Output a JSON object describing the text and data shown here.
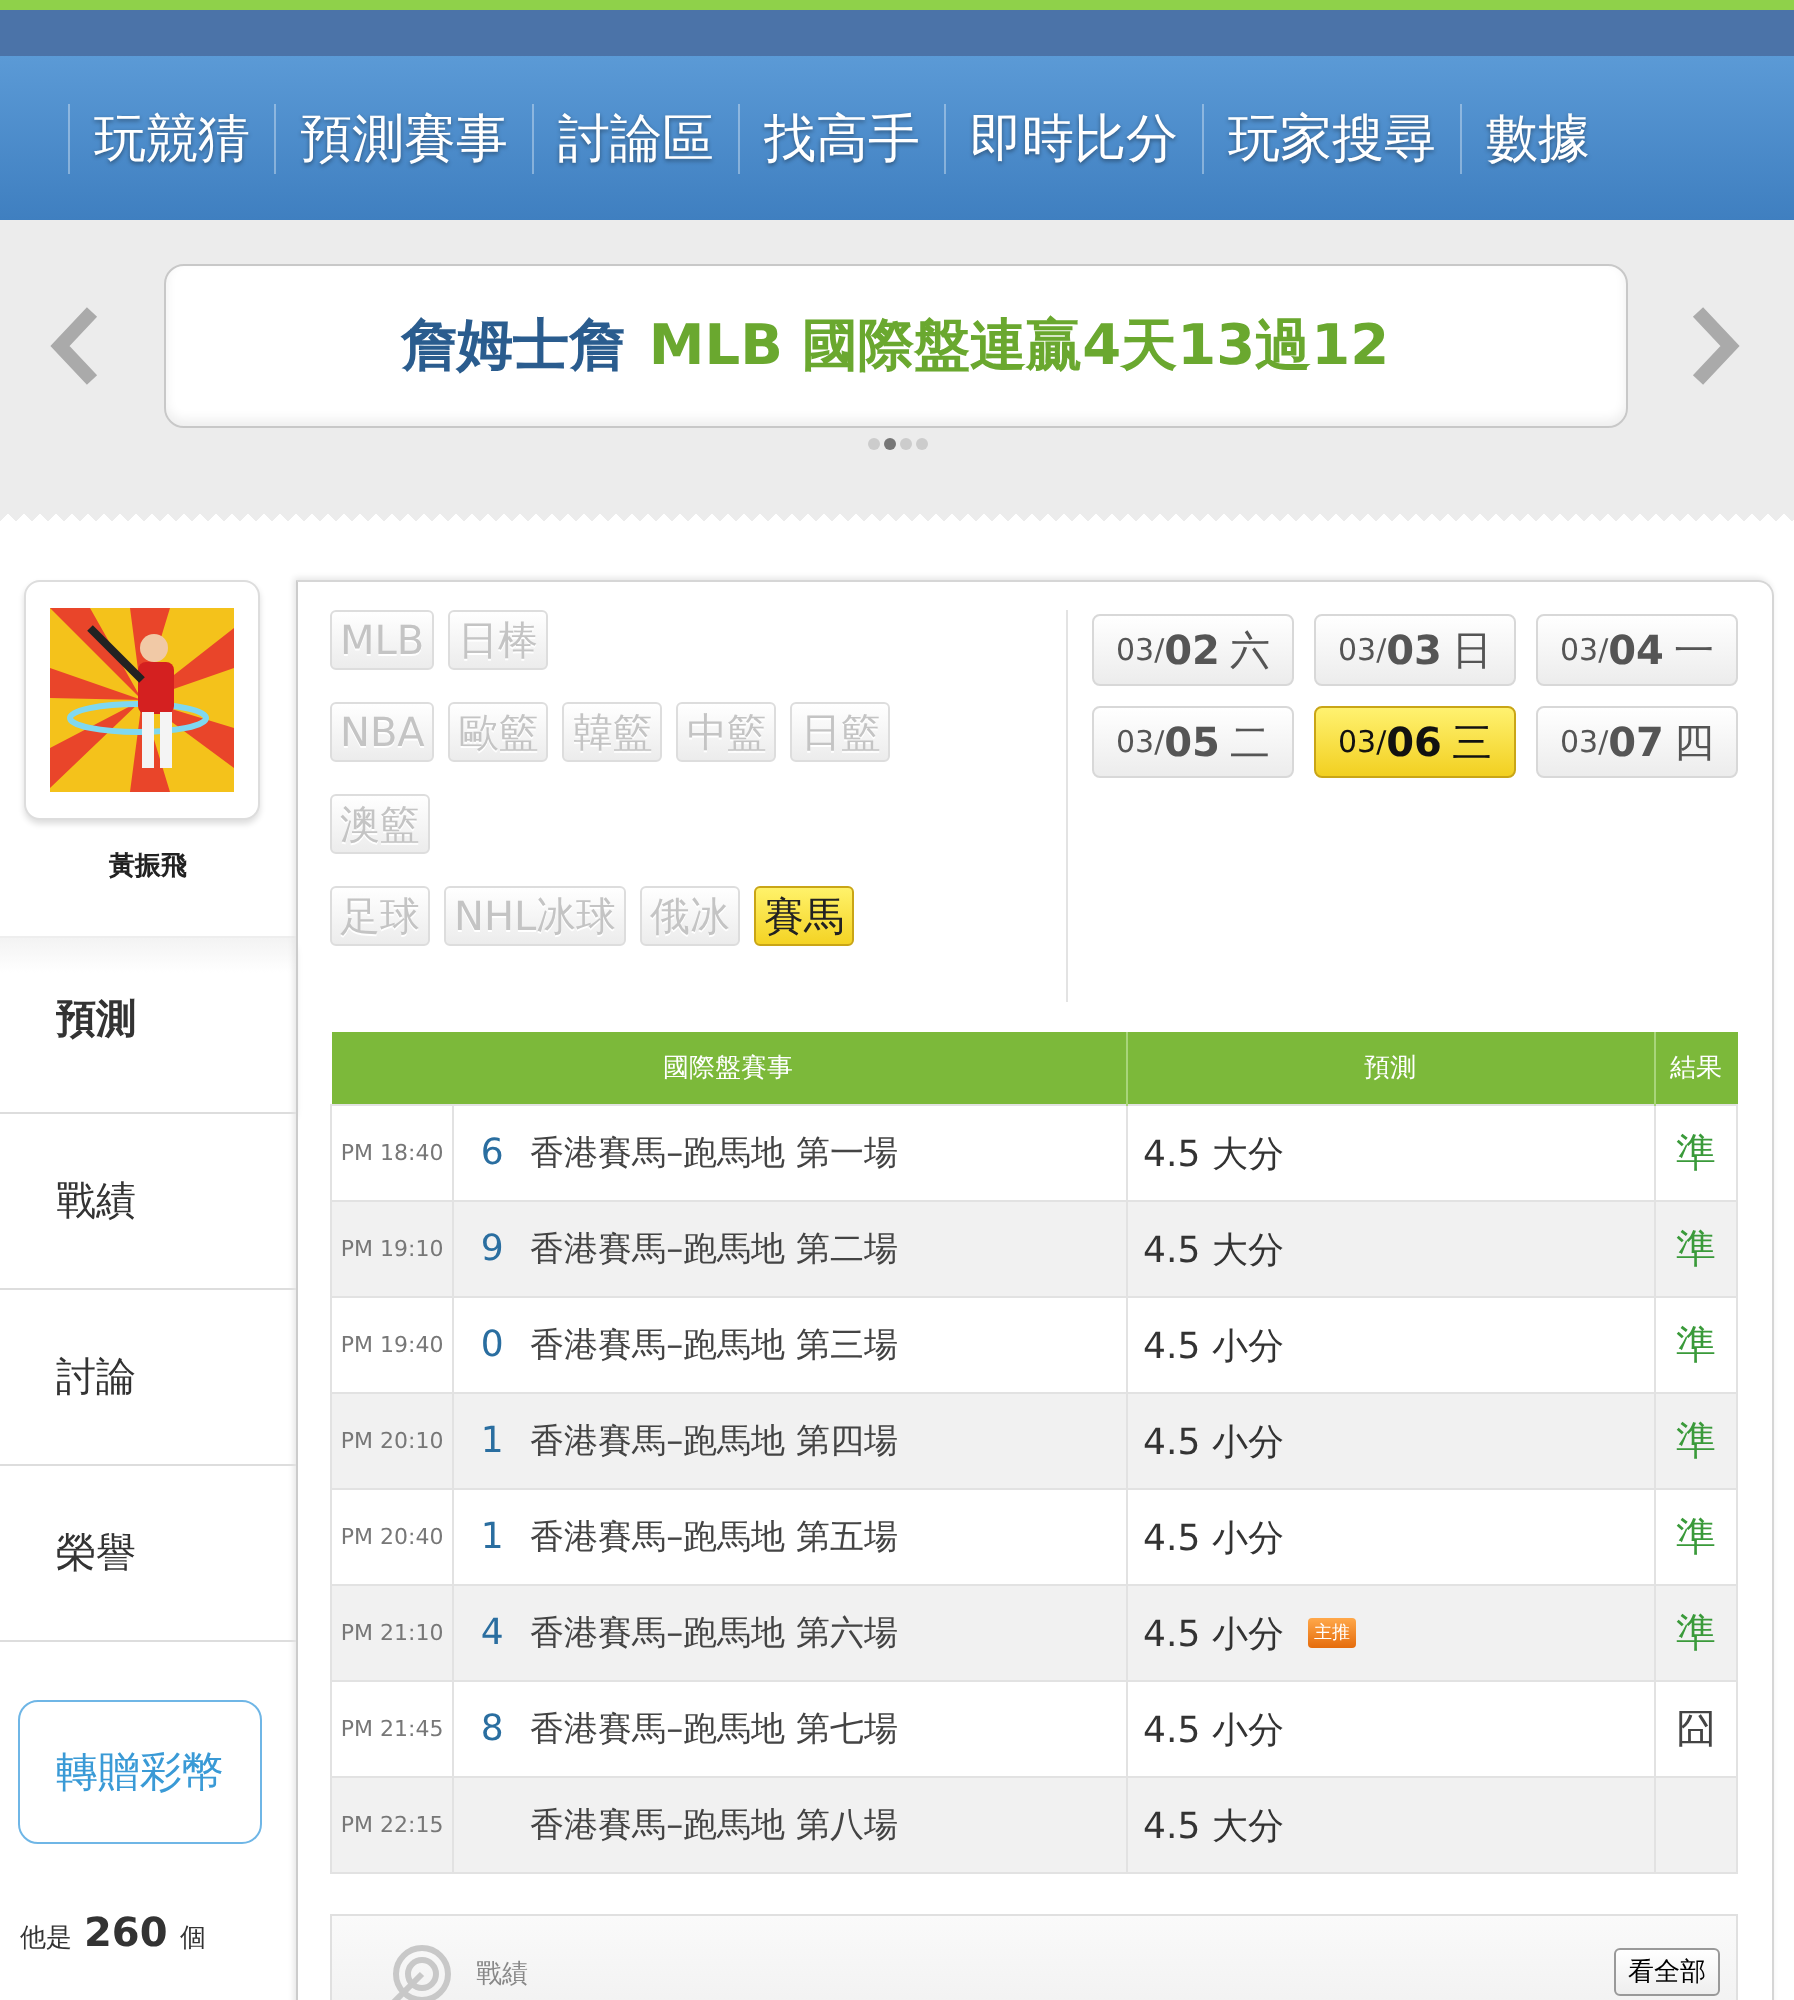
{
  "nav": {
    "items": [
      "玩競猜",
      "預測賽事",
      "討論區",
      "找高手",
      "即時比分",
      "玩家搜尋",
      "數據"
    ]
  },
  "banner": {
    "name": "詹姆士詹",
    "text": "MLB 國際盤連贏4天13過12",
    "dots": [
      {
        "selected": false
      },
      {
        "selected": true
      },
      {
        "selected": false
      },
      {
        "selected": false
      }
    ]
  },
  "profile": {
    "name": "黃振飛"
  },
  "sidebar": {
    "tabs": [
      {
        "label": "預測",
        "selected": true
      },
      {
        "label": "戰績",
        "selected": false
      },
      {
        "label": "討論",
        "selected": false
      },
      {
        "label": "榮譽",
        "selected": false
      }
    ],
    "transfer_button": "轉贈彩幣",
    "stats": {
      "prefix": "他是",
      "count": "260",
      "suffix": "個"
    }
  },
  "leagues": [
    [
      {
        "label": "MLB",
        "selected": false
      },
      {
        "label": "日棒",
        "selected": false
      }
    ],
    [
      {
        "label": "NBA",
        "selected": false
      },
      {
        "label": "歐籃",
        "selected": false
      },
      {
        "label": "韓籃",
        "selected": false
      },
      {
        "label": "中籃",
        "selected": false
      },
      {
        "label": "日籃",
        "selected": false
      }
    ],
    [
      {
        "label": "澳籃",
        "selected": false
      }
    ],
    [
      {
        "label": "足球",
        "selected": false
      },
      {
        "label": "NHL冰球",
        "selected": false
      },
      {
        "label": "俄冰",
        "selected": false
      },
      {
        "label": "賽馬",
        "selected": true
      }
    ]
  ],
  "dates": [
    {
      "month": "03/",
      "day": "02",
      "weekday": "六",
      "selected": false
    },
    {
      "month": "03/",
      "day": "03",
      "weekday": "日",
      "selected": false
    },
    {
      "month": "03/",
      "day": "04",
      "weekday": "一",
      "selected": false
    },
    {
      "month": "03/",
      "day": "05",
      "weekday": "二",
      "selected": false
    },
    {
      "month": "03/",
      "day": "06",
      "weekday": "三",
      "selected": true
    },
    {
      "month": "03/",
      "day": "07",
      "weekday": "四",
      "selected": false
    }
  ],
  "table": {
    "columns": [
      "國際盤賽事",
      "預測",
      "結果"
    ],
    "rows": [
      {
        "time": "PM 18:40",
        "number": "6",
        "match": "香港賽馬–跑馬地 第一場",
        "prediction": "4.5 大分",
        "result": "準",
        "correct": true
      },
      {
        "time": "PM 19:10",
        "number": "9",
        "match": "香港賽馬–跑馬地 第二場",
        "prediction": "4.5 大分",
        "result": "準",
        "correct": true
      },
      {
        "time": "PM 19:40",
        "number": "0",
        "match": "香港賽馬–跑馬地 第三場",
        "prediction": "4.5 小分",
        "result": "準",
        "correct": true
      },
      {
        "time": "PM 20:10",
        "number": "1",
        "match": "香港賽馬–跑馬地 第四場",
        "prediction": "4.5 小分",
        "result": "準",
        "correct": true
      },
      {
        "time": "PM 20:40",
        "number": "1",
        "match": "香港賽馬–跑馬地 第五場",
        "prediction": "4.5 小分",
        "result": "準",
        "correct": true
      },
      {
        "time": "PM 21:10",
        "number": "4",
        "match": "香港賽馬–跑馬地 第六場",
        "prediction": "4.5 小分",
        "badge": "主推",
        "result": "準",
        "correct": true
      },
      {
        "time": "PM 21:45",
        "number": "8",
        "match": "香港賽馬–跑馬地 第七場",
        "prediction": "4.5 小分",
        "result": "囧",
        "correct": false
      },
      {
        "time": "PM 22:15",
        "match": "香港賽馬–跑馬地 第八場",
        "prediction": "4.5 大分"
      }
    ]
  },
  "record_card": {
    "title": "戰績",
    "button": "看全部"
  }
}
